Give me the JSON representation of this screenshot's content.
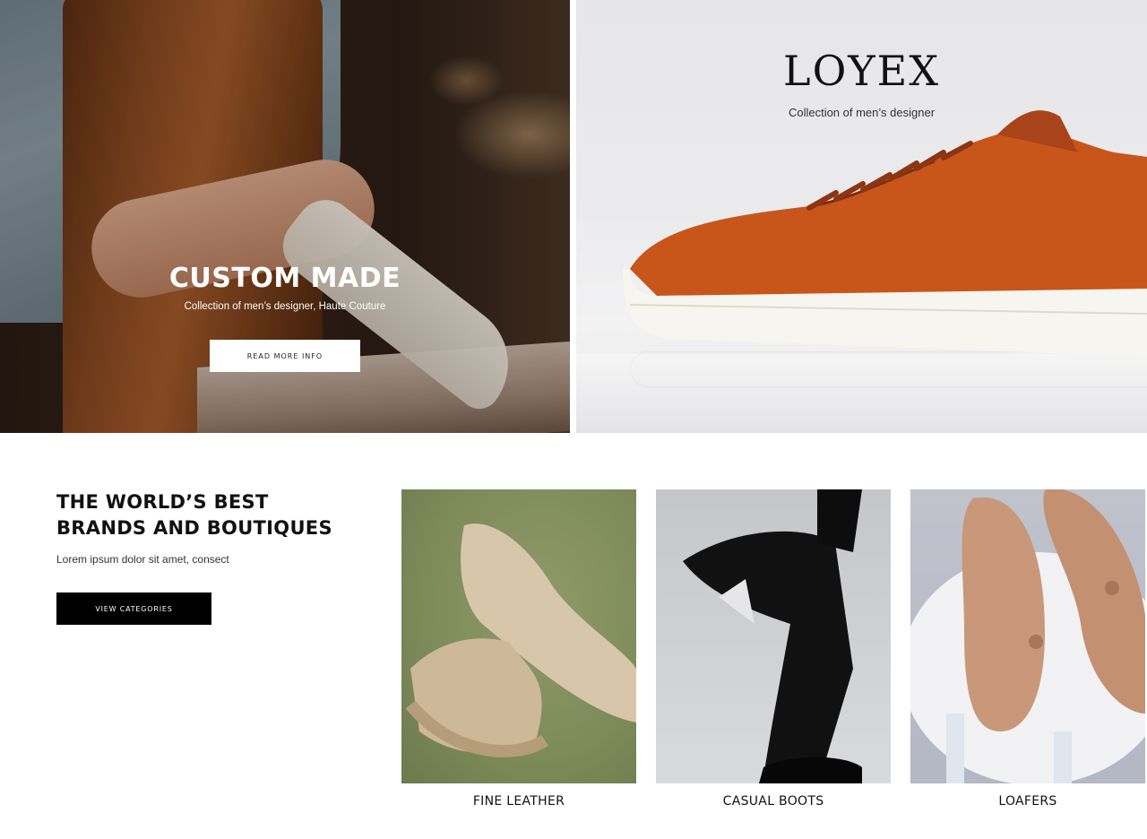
{
  "hero_left": {
    "title": "CUSTOM MADE",
    "subtitle": "Collection of men’s designer, Haute Couture",
    "button_label": "READ MORE INFO"
  },
  "hero_right": {
    "brand": "LOYEX",
    "tagline": "Collection of men’s designer"
  },
  "brands_section": {
    "heading": "THE WORLD’S BEST BRANDS AND BOUTIQUES",
    "text": "Lorem ipsum dolor sit amet, consect",
    "button_label": "VIEW CATEGORIES"
  },
  "categories": [
    {
      "label": "FINE LEATHER"
    },
    {
      "label": "CASUAL BOOTS"
    },
    {
      "label": "LOAFERS"
    }
  ],
  "colors": {
    "accent_dark": "#000000",
    "sneaker": "#c8561b"
  }
}
